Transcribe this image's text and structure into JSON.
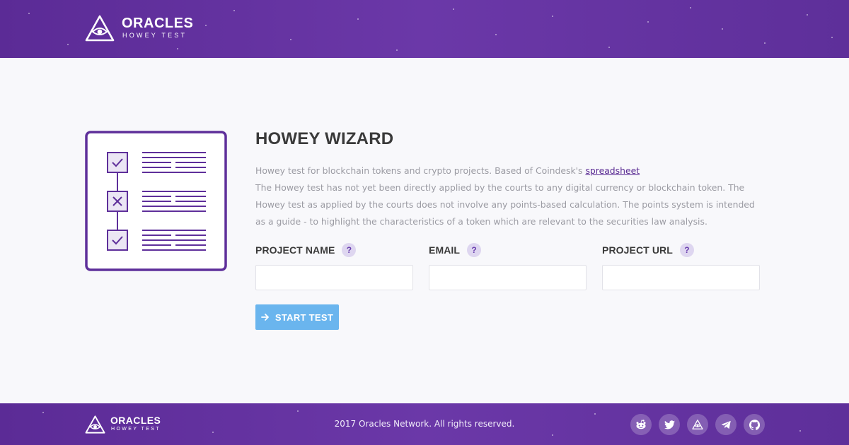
{
  "brand": {
    "name": "ORACLES",
    "subtitle": "HOWEY TEST"
  },
  "main": {
    "title": "HOWEY WIZARD",
    "intro": "Howey test for blockchain tokens and crypto projects. Based of Coindesk's",
    "intro_link": "spreadsheet",
    "disclaimer": "The Howey test has not yet been directly applied by the courts to any digital currency or blockchain token. The Howey test as applied by the courts does not involve any points-based calculation. The points system is intended as a guide - to highlight the characteristics of a token which are relevant to the securities law analysis."
  },
  "form": {
    "fields": [
      {
        "label": "PROJECT NAME",
        "help": "?",
        "value": "",
        "placeholder": ""
      },
      {
        "label": "EMAIL",
        "help": "?",
        "value": "",
        "placeholder": ""
      },
      {
        "label": "PROJECT URL",
        "help": "?",
        "value": "",
        "placeholder": ""
      }
    ],
    "submit_label": "START TEST"
  },
  "illustration": {
    "icon": "checklist-icon",
    "items": [
      "checked",
      "crossed",
      "checked"
    ]
  },
  "footer": {
    "copyright": "2017 Oracles Network. All rights reserved.",
    "social": [
      "reddit-icon",
      "twitter-icon",
      "oracles-icon",
      "telegram-icon",
      "github-icon"
    ]
  },
  "colors": {
    "brand_purple": "#5e2f9a",
    "button_blue": "#6ab5ee",
    "link_purple": "#5a2b93",
    "help_badge": "#ded6f0"
  }
}
